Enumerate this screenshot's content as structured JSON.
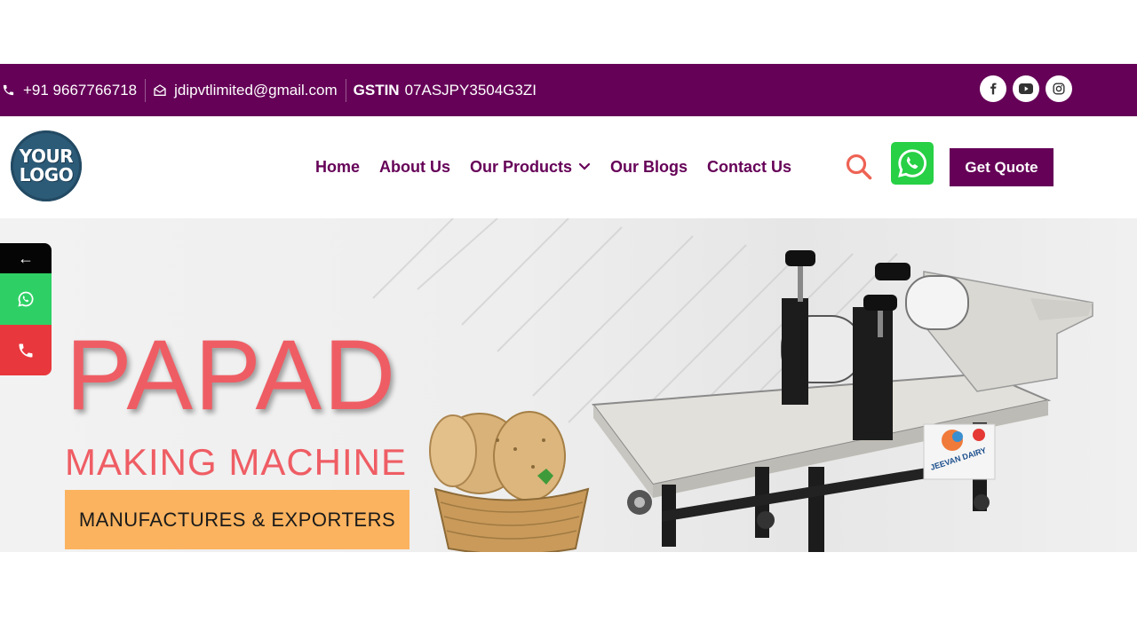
{
  "topbar": {
    "phone": "+91 9667766718",
    "email": "jdipvtlimited@gmail.com",
    "gstin_label": "GSTIN",
    "gstin_value": "07ASJPY3504G3ZI",
    "social_icons": [
      "facebook-icon",
      "youtube-icon",
      "instagram-icon"
    ]
  },
  "header": {
    "logo_line1": "YOUR",
    "logo_line2": "LOGO",
    "nav": [
      {
        "label": "Home"
      },
      {
        "label": "About Us"
      },
      {
        "label": "Our Products"
      },
      {
        "label": "Our Blogs"
      },
      {
        "label": "Contact Us"
      }
    ],
    "quote_label": "Get Quote"
  },
  "hero": {
    "title": "PAPAD",
    "subtitle": "MAKING MACHINE",
    "badge": "MANUFACTURES & EXPORTERS",
    "machine_brand": "JEEVAN DAIRY"
  },
  "side": {
    "back_glyph": "←"
  },
  "colors": {
    "brand_purple": "#650157",
    "accent_red": "#ef5d64",
    "badge_orange": "#fbb35f",
    "whatsapp_green": "#27d045",
    "call_red": "#e8383d"
  }
}
